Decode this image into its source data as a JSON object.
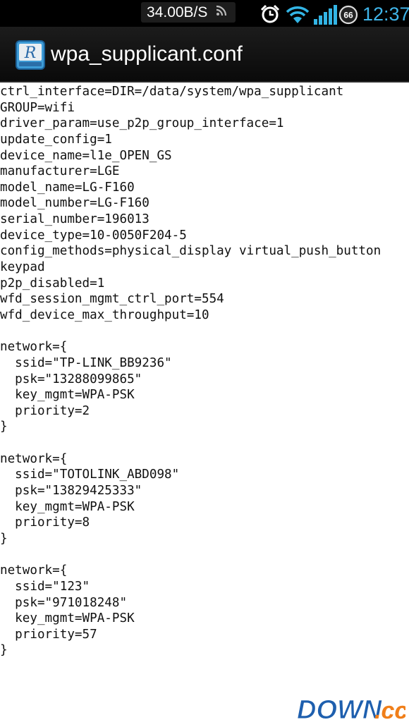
{
  "status_bar": {
    "net_speed": "34.00B/S",
    "battery_level": "66",
    "time": "12:37",
    "icons": [
      "rss-icon",
      "alarm-icon",
      "wifi-icon",
      "signal-icon",
      "battery-icon"
    ]
  },
  "app_bar": {
    "title": "wpa_supplicant.conf",
    "icon": "app-logo-icon",
    "icon_letter": "R"
  },
  "file_lines": [
    "ctrl_interface=DIR=/data/system/wpa_supplicant",
    "GROUP=wifi",
    "driver_param=use_p2p_group_interface=1",
    "update_config=1",
    "device_name=l1e_OPEN_GS",
    "manufacturer=LGE",
    "model_name=LG-F160",
    "model_number=LG-F160",
    "serial_number=196013",
    "device_type=10-0050F204-5",
    "config_methods=physical_display virtual_push_button",
    "keypad",
    "p2p_disabled=1",
    "wfd_session_mgmt_ctrl_port=554",
    "wfd_device_max_throughput=10",
    "",
    "network={",
    "  ssid=\"TP-LINK_BB9236\"",
    "  psk=\"13288099865\"",
    "  key_mgmt=WPA-PSK",
    "  priority=2",
    "}",
    "",
    "network={",
    "  ssid=\"TOTOLINK_ABD098\"",
    "  psk=\"13829425333\"",
    "  key_mgmt=WPA-PSK",
    "  priority=8",
    "}",
    "",
    "network={",
    "  ssid=\"123\"",
    "  psk=\"971018248\"",
    "  key_mgmt=WPA-PSK",
    "  priority=57",
    "}"
  ],
  "watermark": {
    "text_main": "DOWN",
    "text_suffix": ".cc"
  },
  "colors": {
    "status_bg": "#000000",
    "clock": "#3fb4e8",
    "accent_blue": "#33b5e5",
    "title_bg": "#111111",
    "text": "#111111",
    "watermark_blue": "#1e5fae",
    "watermark_orange": "#f07f1a"
  }
}
